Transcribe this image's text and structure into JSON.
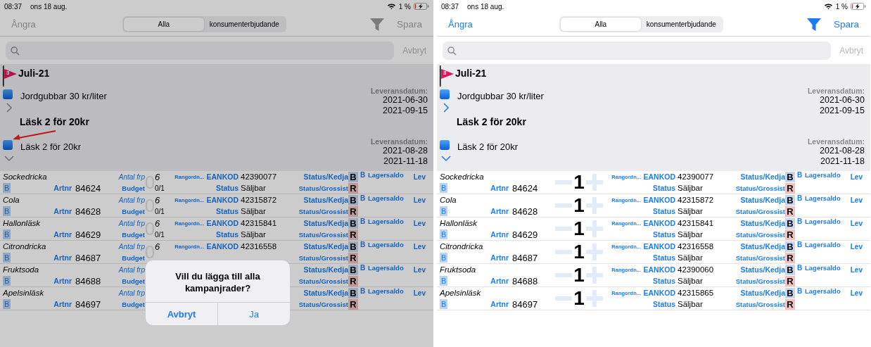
{
  "panels": [
    {
      "dimmed": true,
      "status_bar": {
        "time": "08:37",
        "date": "ons 18 aug.",
        "battery": "1 %"
      },
      "nav": {
        "undo": "Ångra",
        "segments": [
          {
            "label": "Alla",
            "selected": true
          },
          {
            "label": "konsumenterbjudande",
            "selected": false
          }
        ],
        "save": "Spara"
      },
      "search": {
        "cancel": "Avbryt"
      },
      "group": {
        "flag_count": "3",
        "title": "Juli-21",
        "campaigns": [
          {
            "name": "Jordgubbar 30 kr/liter",
            "delivery_label": "Leveransdatum:",
            "start": "2021-06-30",
            "end": "2021-09-15",
            "expanded": false,
            "pointer": false
          },
          {
            "heading": "Läsk 2 för 20kr",
            "name": "Läsk 2 för 20kr",
            "delivery_label": "Leveransdatum:",
            "start": "2021-08-28",
            "end": "2021-11-18",
            "expanded": true,
            "pointer": true
          }
        ]
      },
      "rows": [
        {
          "kind": "count",
          "name": "Sockedricka",
          "badge": "B",
          "artnr_label": "Artnr",
          "artnr": "84624",
          "count_label": "Antal frp",
          "ghost": "0",
          "count": "6",
          "budget_label": "Budget",
          "budget": "0/1",
          "rank": "Rangordn...",
          "ean_label": "EANKOD",
          "ean": "42390077",
          "status_label": "Status",
          "status": "Säljbar",
          "chain_label": "Status/Kedja",
          "chain_badge": "B",
          "chain_small": "B",
          "wholesaler_label": "Status/Grossist",
          "wholesaler_badge": "R",
          "stock": "Lagersaldo",
          "lev": "Lev"
        },
        {
          "kind": "count",
          "name": "Cola",
          "badge": "B",
          "artnr_label": "Artnr",
          "artnr": "84628",
          "count_label": "Antal frp",
          "ghost": "0",
          "count": "6",
          "budget_label": "Budget",
          "budget": "0/1",
          "rank": "Rangordn...",
          "ean_label": "EANKOD",
          "ean": "42315872",
          "status_label": "Status",
          "status": "Säljbar",
          "chain_label": "Status/Kedja",
          "chain_badge": "B",
          "chain_small": "B",
          "wholesaler_label": "Status/Grossist",
          "wholesaler_badge": "R",
          "stock": "Lagersaldo",
          "lev": "Lev"
        },
        {
          "kind": "count",
          "name": "Hallonläsk",
          "badge": "B",
          "artnr_label": "Artnr",
          "artnr": "84629",
          "count_label": "Antal frp",
          "ghost": "0",
          "count": "6",
          "budget_label": "Budget",
          "budget": "0/1",
          "rank": "Rangordn...",
          "ean_label": "EANKOD",
          "ean": "42315841",
          "status_label": "Status",
          "status": "Säljbar",
          "chain_label": "Status/Kedja",
          "chain_badge": "B",
          "chain_small": "B",
          "wholesaler_label": "Status/Grossist",
          "wholesaler_badge": "R",
          "stock": "Lagersaldo",
          "lev": "Lev"
        },
        {
          "kind": "count",
          "name": "Citrondricka",
          "badge": "B",
          "artnr_label": "Artnr",
          "artnr": "84687",
          "count_label": "Antal frp",
          "ghost": "0",
          "count": "6",
          "budget_label": "Budget",
          "rank": "Rangordn...",
          "ean_label": "EANKOD",
          "ean": "42316558",
          "chain_label": "Status/Kedja",
          "chain_badge": "B",
          "chain_small": "B",
          "wholesaler_label": "Status/Grossist",
          "wholesaler_badge": "R",
          "stock": "Lagersaldo",
          "lev": "Lev"
        },
        {
          "kind": "count",
          "name": "Fruktsoda",
          "badge": "B",
          "artnr_label": "Artnr",
          "artnr": "84688",
          "count_label": "Antal frp",
          "budget_label": "Budget",
          "chain_label": "Status/Kedja",
          "chain_badge": "B",
          "chain_small": "B",
          "wholesaler_label": "Status/Grossist",
          "wholesaler_badge": "R",
          "stock": "Lagersaldo",
          "lev": "Lev"
        },
        {
          "kind": "count",
          "name": "Apelsinläsk",
          "badge": "B",
          "artnr_label": "Artnr",
          "artnr": "84697",
          "count_label": "Antal frp",
          "budget_label": "Budget",
          "chain_label": "Status/Kedja",
          "chain_badge": "B",
          "chain_small": "B",
          "wholesaler_label": "Status/Grossist",
          "wholesaler_badge": "R",
          "stock": "Lagersaldo",
          "lev": "Lev"
        }
      ],
      "dialog": {
        "message": "Vill du lägga till alla kampanjrader?",
        "buttons": [
          {
            "label": "Avbryt",
            "kind": "cancel"
          },
          {
            "label": "Ja",
            "kind": "default"
          }
        ]
      }
    },
    {
      "dimmed": false,
      "status_bar": {
        "time": "08:37",
        "date": "ons 18 aug.",
        "battery": "1 %"
      },
      "nav": {
        "undo": "Ångra",
        "segments": [
          {
            "label": "Alla",
            "selected": true
          },
          {
            "label": "konsumenterbjudande",
            "selected": false
          }
        ],
        "save": "Spara"
      },
      "search": {
        "cancel": "Avbryt"
      },
      "group": {
        "flag_count": "3",
        "title": "Juli-21",
        "campaigns": [
          {
            "name": "Jordgubbar 30 kr/liter",
            "delivery_label": "Leveransdatum:",
            "start": "2021-06-30",
            "end": "2021-09-15",
            "expanded": false,
            "pointer": false
          },
          {
            "heading": "Läsk 2 för 20kr",
            "name": "Läsk 2 för 20kr",
            "delivery_label": "Leveransdatum:",
            "start": "2021-08-28",
            "end": "2021-11-18",
            "expanded": true,
            "pointer": false
          }
        ]
      },
      "rows": [
        {
          "kind": "stepper",
          "name": "Sockedricka",
          "badge": "B",
          "artnr_label": "Artnr",
          "artnr": "84624",
          "quantity": "1",
          "rank": "Rangordn...",
          "ean_label": "EANKOD",
          "ean": "42390077",
          "status_label": "Status",
          "status": "Säljbar",
          "chain_label": "Status/Kedja",
          "chain_badge": "B",
          "chain_small": "B",
          "wholesaler_label": "Status/Grossist",
          "wholesaler_badge": "R",
          "stock": "Lagersaldo",
          "lev": "Lev"
        },
        {
          "kind": "stepper",
          "name": "Cola",
          "badge": "B",
          "artnr_label": "Artnr",
          "artnr": "84628",
          "quantity": "1",
          "rank": "Rangordn...",
          "ean_label": "EANKOD",
          "ean": "42315872",
          "status_label": "Status",
          "status": "Säljbar",
          "chain_label": "Status/Kedja",
          "chain_badge": "B",
          "chain_small": "B",
          "wholesaler_label": "Status/Grossist",
          "wholesaler_badge": "R",
          "stock": "Lagersaldo",
          "lev": "Lev"
        },
        {
          "kind": "stepper",
          "name": "Hallonläsk",
          "badge": "B",
          "artnr_label": "Artnr",
          "artnr": "84629",
          "quantity": "1",
          "rank": "Rangordn...",
          "ean_label": "EANKOD",
          "ean": "42315841",
          "status_label": "Status",
          "status": "Säljbar",
          "chain_label": "Status/Kedja",
          "chain_badge": "B",
          "chain_small": "B",
          "wholesaler_label": "Status/Grossist",
          "wholesaler_badge": "R",
          "stock": "Lagersaldo",
          "lev": "Lev"
        },
        {
          "kind": "stepper",
          "name": "Citrondricka",
          "badge": "B",
          "artnr_label": "Artnr",
          "artnr": "84687",
          "quantity": "1",
          "rank": "Rangordn...",
          "ean_label": "EANKOD",
          "ean": "42316558",
          "status_label": "Status",
          "status": "Säljbar",
          "chain_label": "Status/Kedja",
          "chain_badge": "B",
          "chain_small": "B",
          "wholesaler_label": "Status/Grossist",
          "wholesaler_badge": "R",
          "stock": "Lagersaldo",
          "lev": "Lev"
        },
        {
          "kind": "stepper",
          "name": "Fruktsoda",
          "badge": "B",
          "artnr_label": "Artnr",
          "artnr": "84688",
          "quantity": "1",
          "rank": "Rangordn...",
          "ean_label": "EANKOD",
          "ean": "42390060",
          "status_label": "Status",
          "status": "Säljbar",
          "chain_label": "Status/Kedja",
          "chain_badge": "B",
          "chain_small": "B",
          "wholesaler_label": "Status/Grossist",
          "wholesaler_badge": "R",
          "stock": "Lagersaldo",
          "lev": "Lev"
        },
        {
          "kind": "stepper",
          "name": "Apelsinläsk",
          "badge": "B",
          "artnr_label": "Artnr",
          "artnr": "84697",
          "quantity": "1",
          "rank": "Rangordn...",
          "ean_label": "EANKOD",
          "ean": "42315865",
          "status_label": "Status",
          "status": "Säljbar",
          "chain_label": "Status/Kedja",
          "chain_badge": "B",
          "chain_small": "B",
          "wholesaler_label": "Status/Grossist",
          "wholesaler_badge": "R",
          "stock": "Lagersaldo",
          "lev": "Lev"
        }
      ]
    }
  ]
}
